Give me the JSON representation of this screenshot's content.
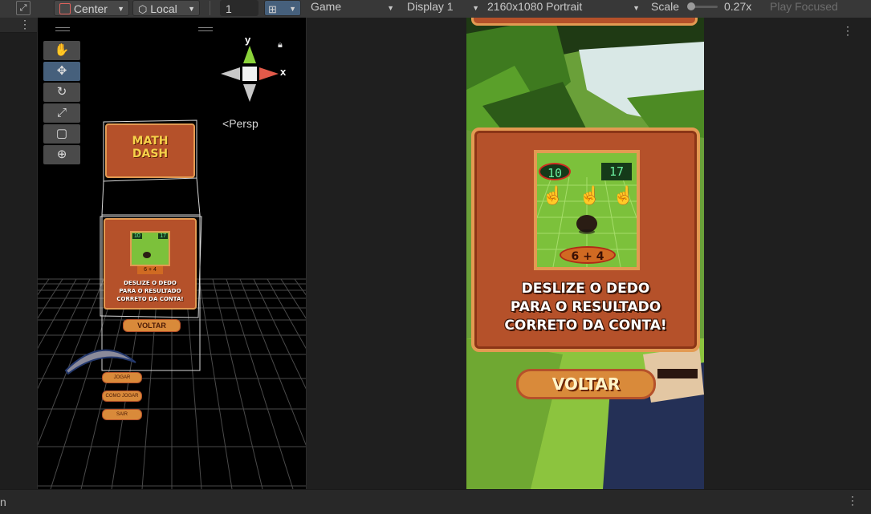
{
  "scene_toolbar": {
    "pivot_label": "Center",
    "space_label": "Local",
    "grid_value": "1",
    "more_label": "⋮"
  },
  "scene": {
    "axis_y": "y",
    "axis_x": "x",
    "persp_label": "Persp",
    "menu_title": "MATH\nDASH",
    "menu_panel_text": "DESLIZE O DEDO\nPARA O RESULTADO\nCORRETO DA CONTA!",
    "menu_voltar": "VOLTAR",
    "mini_num_left": "10",
    "mini_num_right": "17",
    "mini_equation": "6 + 4",
    "mini_btn_1": "JOGAR",
    "mini_btn_2": "COMO JOGAR",
    "mini_btn_3": "SAIR"
  },
  "tools": [
    {
      "name": "hand-tool",
      "icon": "✋",
      "active": false
    },
    {
      "name": "move-tool",
      "icon": "✥",
      "active": true
    },
    {
      "name": "rotate-tool",
      "icon": "↻",
      "active": false
    },
    {
      "name": "scale-tool",
      "icon": "⤢",
      "active": false
    },
    {
      "name": "rect-tool",
      "icon": "▢",
      "active": false
    },
    {
      "name": "transform-tool",
      "icon": "⊕",
      "active": false
    }
  ],
  "game_toolbar": {
    "game_label": "Game",
    "display_label": "Display 1",
    "resolution_label": "2160x1080 Portrait",
    "scale_label": "Scale",
    "scale_value": "0.27x",
    "play_focused_label": "Play Focused",
    "more_label": "⋮"
  },
  "game": {
    "panel_text_line1": "DESLIZE O DEDO",
    "panel_text_line2": "PARA O RESULTADO",
    "panel_text_line3": "CORRETO DA CONTA!",
    "num_left": "10",
    "num_right": "17",
    "equation": "6 + 4",
    "voltar_label": "VOLTAR"
  },
  "bottom_bar": {
    "left_text": "n",
    "more_label": "⋮"
  },
  "colors": {
    "accent": "#46607c",
    "wood": "#b5512a",
    "wood_border": "#e39a52",
    "grass": "#7cc13b",
    "button_orange": "#d98a3a"
  }
}
